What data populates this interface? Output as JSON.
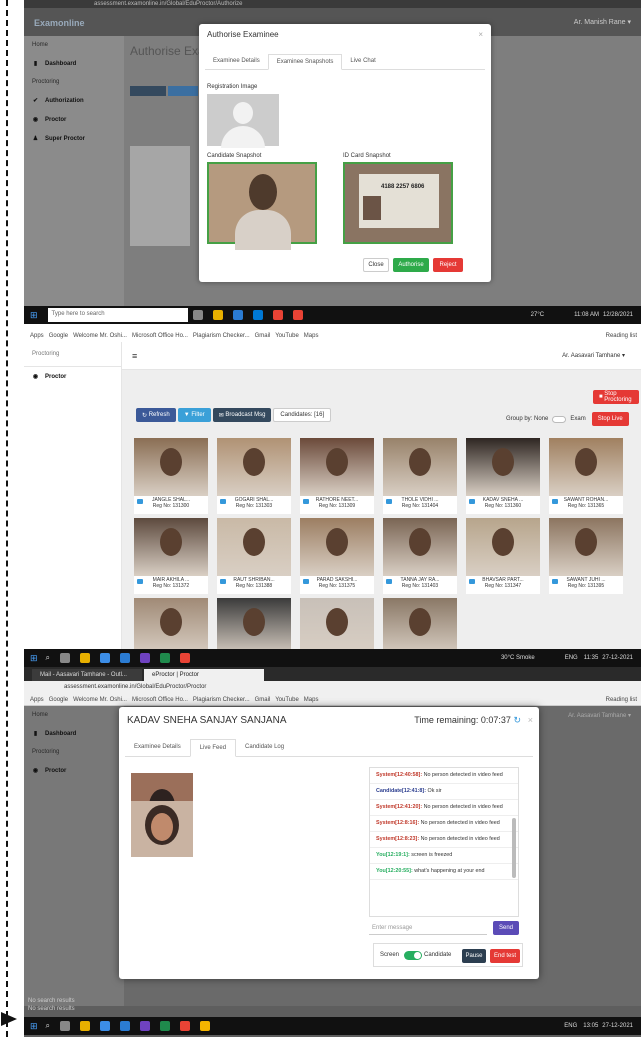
{
  "shot1": {
    "url": "assessment.examonline.in/Global/EduProctor/Authorize",
    "brand": "Examonline",
    "user": "Ar. Manish Rane ▾",
    "page_title": "Authorise Exam",
    "sidebar": {
      "home": "Home",
      "dashboard": "Dashboard",
      "proctoring": "Proctoring",
      "authorization": "Authorization",
      "proctor": "Proctor",
      "super_proctor": "Super Proctor"
    },
    "modal": {
      "title": "Authorise Examinee",
      "close": "×",
      "tabs": [
        "Examinee Details",
        "Examinee Snapshots",
        "Live Chat"
      ],
      "registration_image": "Registration Image",
      "candidate_snapshot": "Candidate Snapshot",
      "id_card_snapshot": "ID Card Snapshot",
      "id_number": "4188 2257 6806",
      "close_btn": "Close",
      "authorise_btn": "Authorise",
      "reject_btn": "Reject"
    },
    "taskbar": {
      "search": "Type here to search",
      "weather": "27°C",
      "time": "11:08 AM",
      "date": "12/28/2021"
    }
  },
  "shot2": {
    "bookmarks": [
      "Apps",
      "Google",
      "Welcome Mr. Oshi...",
      "Microsoft Office Ho...",
      "Plagiarism Checker...",
      "Gmail",
      "YouTube",
      "Maps"
    ],
    "reading_list": "Reading list",
    "proctoring": "Proctoring",
    "proctor": "Proctor",
    "user": "Ar. Aasavari Tamhane ▾",
    "stop_proctoring": "Stop Proctoring",
    "refresh": "Refresh",
    "filter": "Filter",
    "broadcast": "Broadcast Msg",
    "cand_count": "Candidates: [16]",
    "group_by": "Group by: None",
    "exam": "Exam",
    "stop_live": "Stop Live",
    "candidates": [
      {
        "name": "JANGLE SHAL...",
        "reg": "Reg No: 131300",
        "tone": "#8a6e54"
      },
      {
        "name": "GOGARI SHAL...",
        "reg": "Reg No: 131303",
        "tone": "#b09274"
      },
      {
        "name": "RATHORE NEET...",
        "reg": "Reg No: 131309",
        "tone": "#6b4a3a"
      },
      {
        "name": "THOLE VIDHI ...",
        "reg": "Reg No: 131404",
        "tone": "#98826a"
      },
      {
        "name": "KADAV SNEHA ...",
        "reg": "Reg No: 131360",
        "tone": "#2e2622"
      },
      {
        "name": "SAWANT ROHAN...",
        "reg": "Reg No: 131365",
        "tone": "#a08060"
      },
      {
        "name": "MAIR AKHILA ...",
        "reg": "Reg No: 131372",
        "tone": "#5d4a3e"
      },
      {
        "name": "RAUT SHRIBAN...",
        "reg": "Reg No: 131388",
        "tone": "#c9b9a6"
      },
      {
        "name": "PARAD SAKSHI...",
        "reg": "Reg No: 131375",
        "tone": "#9c7e62"
      },
      {
        "name": "TANNA JAY RA...",
        "reg": "Reg No: 131403",
        "tone": "#7a6554"
      },
      {
        "name": "BHAVSAR PART...",
        "reg": "Reg No: 131347",
        "tone": "#b7a58c"
      },
      {
        "name": "SAWANT JUHI ...",
        "reg": "Reg No: 131395",
        "tone": "#8c7560"
      },
      {
        "name": "",
        "reg": "",
        "tone": "#a08a76"
      },
      {
        "name": "",
        "reg": "",
        "tone": "#3b3b3b"
      },
      {
        "name": "",
        "reg": "",
        "tone": "#c8c0b8"
      },
      {
        "name": "",
        "reg": "",
        "tone": "#8a7866"
      }
    ],
    "taskbar": {
      "weather": "30°C Smoke",
      "lang": "ENG",
      "time": "11:35",
      "date": "27-12-2021"
    }
  },
  "shot3": {
    "tabs": [
      "Mail - Aasavari Tamhane - Outl...",
      "eProctor | Proctor"
    ],
    "address": "assessment.examonline.in/Global/EduProctor/Proctor",
    "bookmarks": [
      "Apps",
      "Google",
      "Welcome Mr. Oshi...",
      "Microsoft Office Ho...",
      "Plagiarism Checker...",
      "Gmail",
      "YouTube",
      "Maps"
    ],
    "reading_list": "Reading list",
    "user": "Ar. Aasavari Tamhane ▾",
    "sidebar": {
      "home": "Home",
      "dashboard": "Dashboard",
      "proctoring": "Proctoring",
      "proctor": "Proctor"
    },
    "modal": {
      "title": "KADAV SNEHA SANJAY SANJANA",
      "timer": "Time remaining: 0:07:37",
      "tabs": [
        "Examinee Details",
        "Live Feed",
        "Candidate Log"
      ],
      "messages": [
        {
          "who": "System[12:40:58]:",
          "text": " No person detected in video feed",
          "cls": "red"
        },
        {
          "who": "Candidate[12:41:8]:",
          "text": " Ok sir",
          "cls": "blue"
        },
        {
          "who": "System[12:41:20]:",
          "text": " No person detected in video feed",
          "cls": "red"
        },
        {
          "who": "System[12:8:16]:",
          "text": " No person detected in video feed",
          "cls": "red"
        },
        {
          "who": "System[12:8:23]:",
          "text": " No person detected in video feed",
          "cls": "red"
        },
        {
          "who": "You[12:19:1]:",
          "text": " screen is freezed",
          "cls": "green"
        },
        {
          "who": "You[12:20:55]:",
          "text": " what's happening at your end",
          "cls": "green"
        }
      ],
      "placeholder": "Enter message",
      "send": "Send",
      "screen": "Screen",
      "candidate": "Candidate",
      "pause": "Pause",
      "end_test": "End test"
    },
    "search_results": [
      "No search results",
      "No search results"
    ],
    "taskbar": {
      "lang": "ENG",
      "time": "13:05",
      "date": "27-12-2021"
    }
  }
}
